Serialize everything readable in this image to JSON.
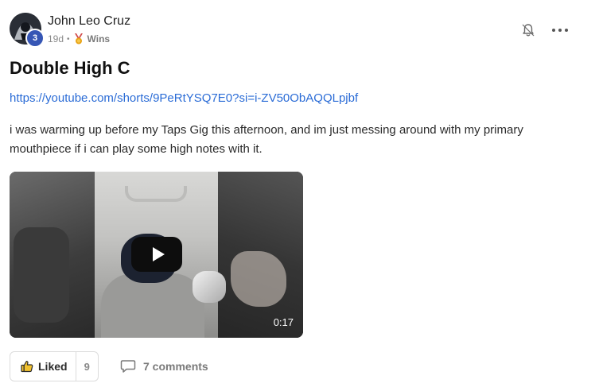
{
  "post": {
    "author": {
      "name": "John Leo Cruz",
      "level": "3"
    },
    "time_ago": "19d",
    "separator": "•",
    "category": "Wins",
    "title": "Double High C",
    "link": "https://youtube.com/shorts/9PeRtYSQ7E0?si=i-ZV50ObAQQLpjbf",
    "body": "i was warming up before my Taps Gig this afternoon, and im just messing around with my primary mouthpiece if i can play some high notes with it.",
    "video": {
      "duration": "0:17"
    },
    "actions": {
      "like_label": "Liked",
      "like_count": "9",
      "comments_label": "7 comments"
    }
  },
  "icons": {
    "notification": "bell-outline-icon",
    "more": "more-horizontal-icon",
    "category": "medal-icon",
    "like": "thumbs-up-icon",
    "comment": "comment-bubble-icon",
    "play": "play-icon"
  },
  "colors": {
    "link": "#2b6cd6",
    "level_badge": "#3656b5",
    "medal": "#e8a317"
  }
}
